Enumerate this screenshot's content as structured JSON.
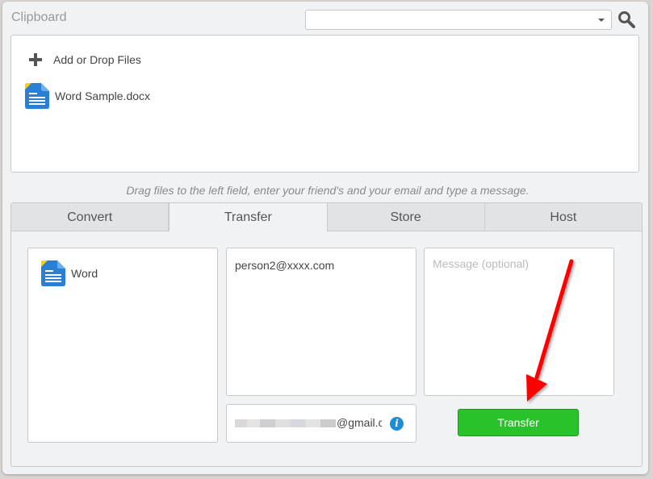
{
  "header": {
    "title": "Clipboard",
    "search_select_value": ""
  },
  "files": {
    "add_label": "Add or Drop Files",
    "items": [
      {
        "name": "Word Sample.docx",
        "icon": "word-document-icon"
      }
    ]
  },
  "hint": "Drag files to the left field, enter your friend's and your email and type a message.",
  "tabs": [
    {
      "label": "Convert",
      "active": false
    },
    {
      "label": "Transfer",
      "active": true
    },
    {
      "label": "Store",
      "active": false
    },
    {
      "label": "Host",
      "active": false
    }
  ],
  "transfer": {
    "format_label": "Word",
    "recipient_email": "person2@xxxx.com",
    "message_placeholder": "Message (optional)",
    "sender_email_visible": "@gmail.c",
    "submit_label": "Transfer"
  },
  "colors": {
    "accent_green": "#29c22a",
    "info_blue": "#1f8dd6",
    "annotation_red": "#ff0000",
    "doc_blue": "#2a7fd4"
  }
}
